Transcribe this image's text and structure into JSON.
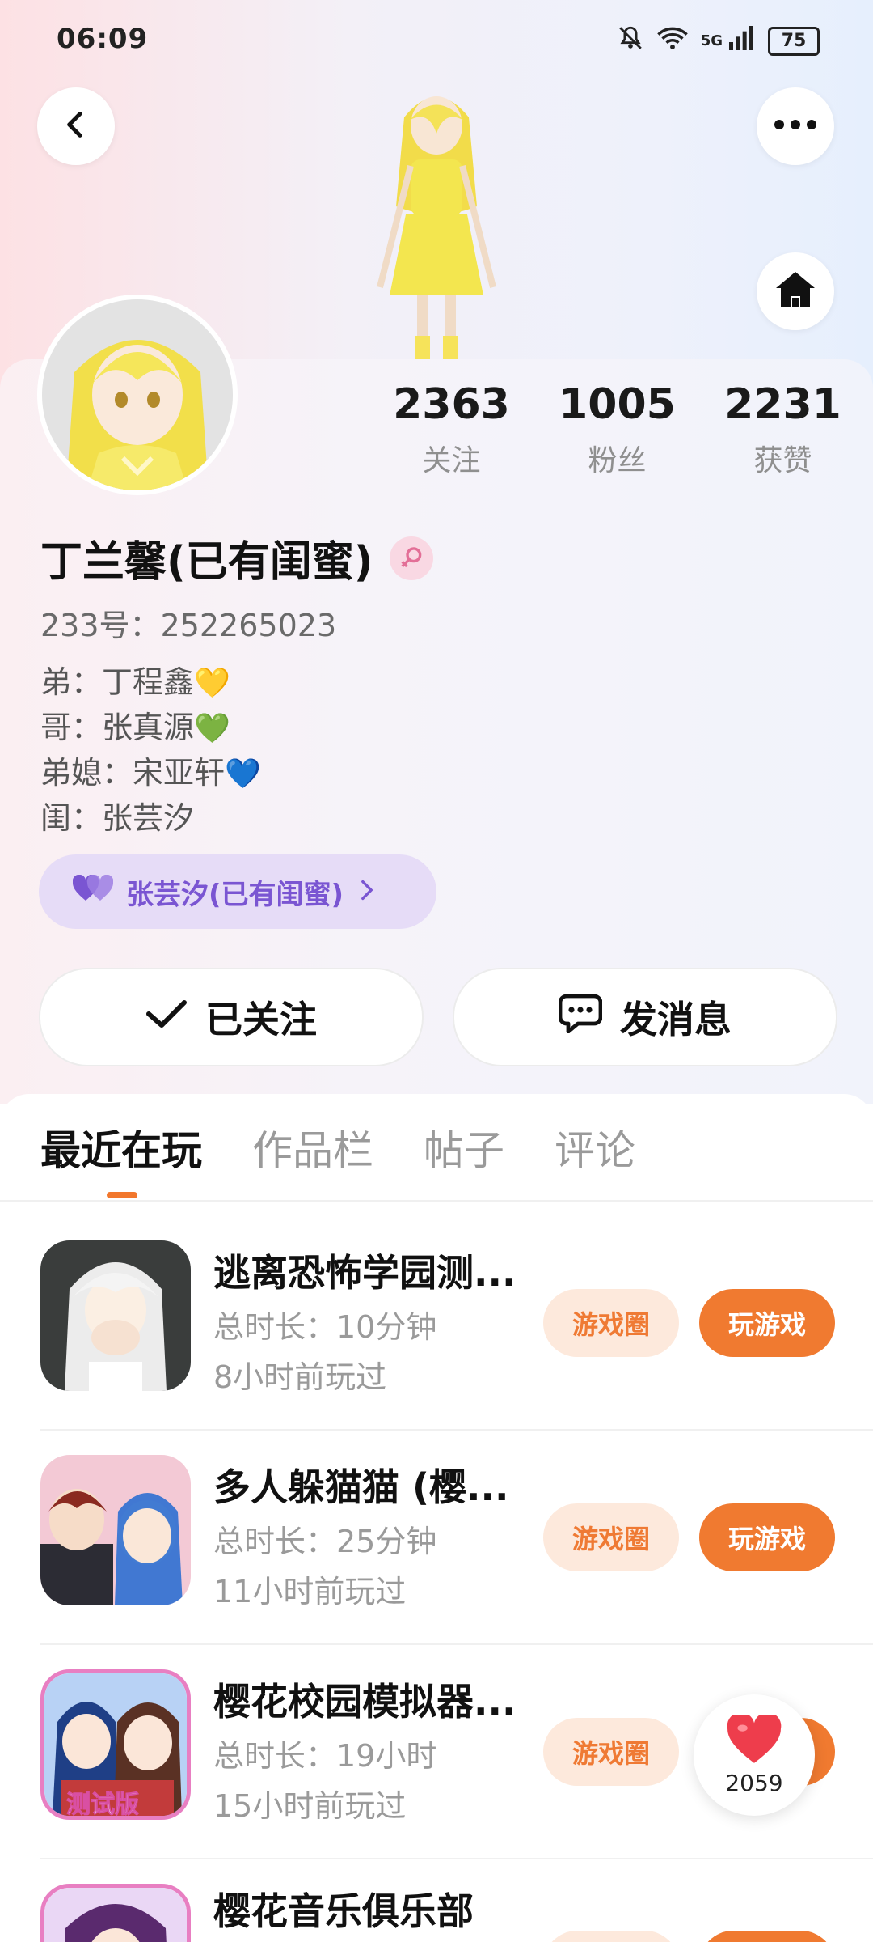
{
  "status_bar": {
    "time": "06:09",
    "network": "5G",
    "battery": "75"
  },
  "profile": {
    "name": "丁兰馨(已有闺蜜)",
    "uid": "233号：252265023",
    "stats": [
      {
        "value": "2363",
        "label": "关注"
      },
      {
        "value": "1005",
        "label": "粉丝"
      },
      {
        "value": "2231",
        "label": "获赞"
      }
    ],
    "bio": [
      {
        "text": "弟：丁程鑫",
        "heart": "💛"
      },
      {
        "text": "哥：张真源",
        "heart": "💚"
      },
      {
        "text": "弟媳：宋亚轩",
        "heart": "💙"
      },
      {
        "text": "闺：张芸汐",
        "heart": ""
      }
    ],
    "bestie_label": "张芸汐(已有闺蜜)"
  },
  "actions": {
    "follow_label": "已关注",
    "message_label": "发消息"
  },
  "tabs": [
    "最近在玩",
    "作品栏",
    "帖子",
    "评论"
  ],
  "games": [
    {
      "title": "逃离恐怖学园测...",
      "duration": "总时长：10分钟",
      "last_played": "8小时前玩过",
      "circle_label": "游戏圈",
      "play_label": "玩游戏"
    },
    {
      "title": "多人躲猫猫 (樱...",
      "duration": "总时长：25分钟",
      "last_played": "11小时前玩过",
      "circle_label": "游戏圈",
      "play_label": "玩游戏"
    },
    {
      "title": "樱花校园模拟器...",
      "duration": "总时长：19小时",
      "last_played": "15小时前玩过",
      "circle_label": "游戏圈",
      "play_label": "玩游戏",
      "badge": "测试版"
    },
    {
      "title": "樱花音乐俱乐部",
      "duration": "",
      "last_played": "",
      "circle_label": "",
      "play_label": ""
    }
  ],
  "like_fab": {
    "count": "2059"
  },
  "colors": {
    "accent": "#f07a30",
    "bestie_bg": "#e6dcf7",
    "bestie_text": "#7a55d2"
  }
}
